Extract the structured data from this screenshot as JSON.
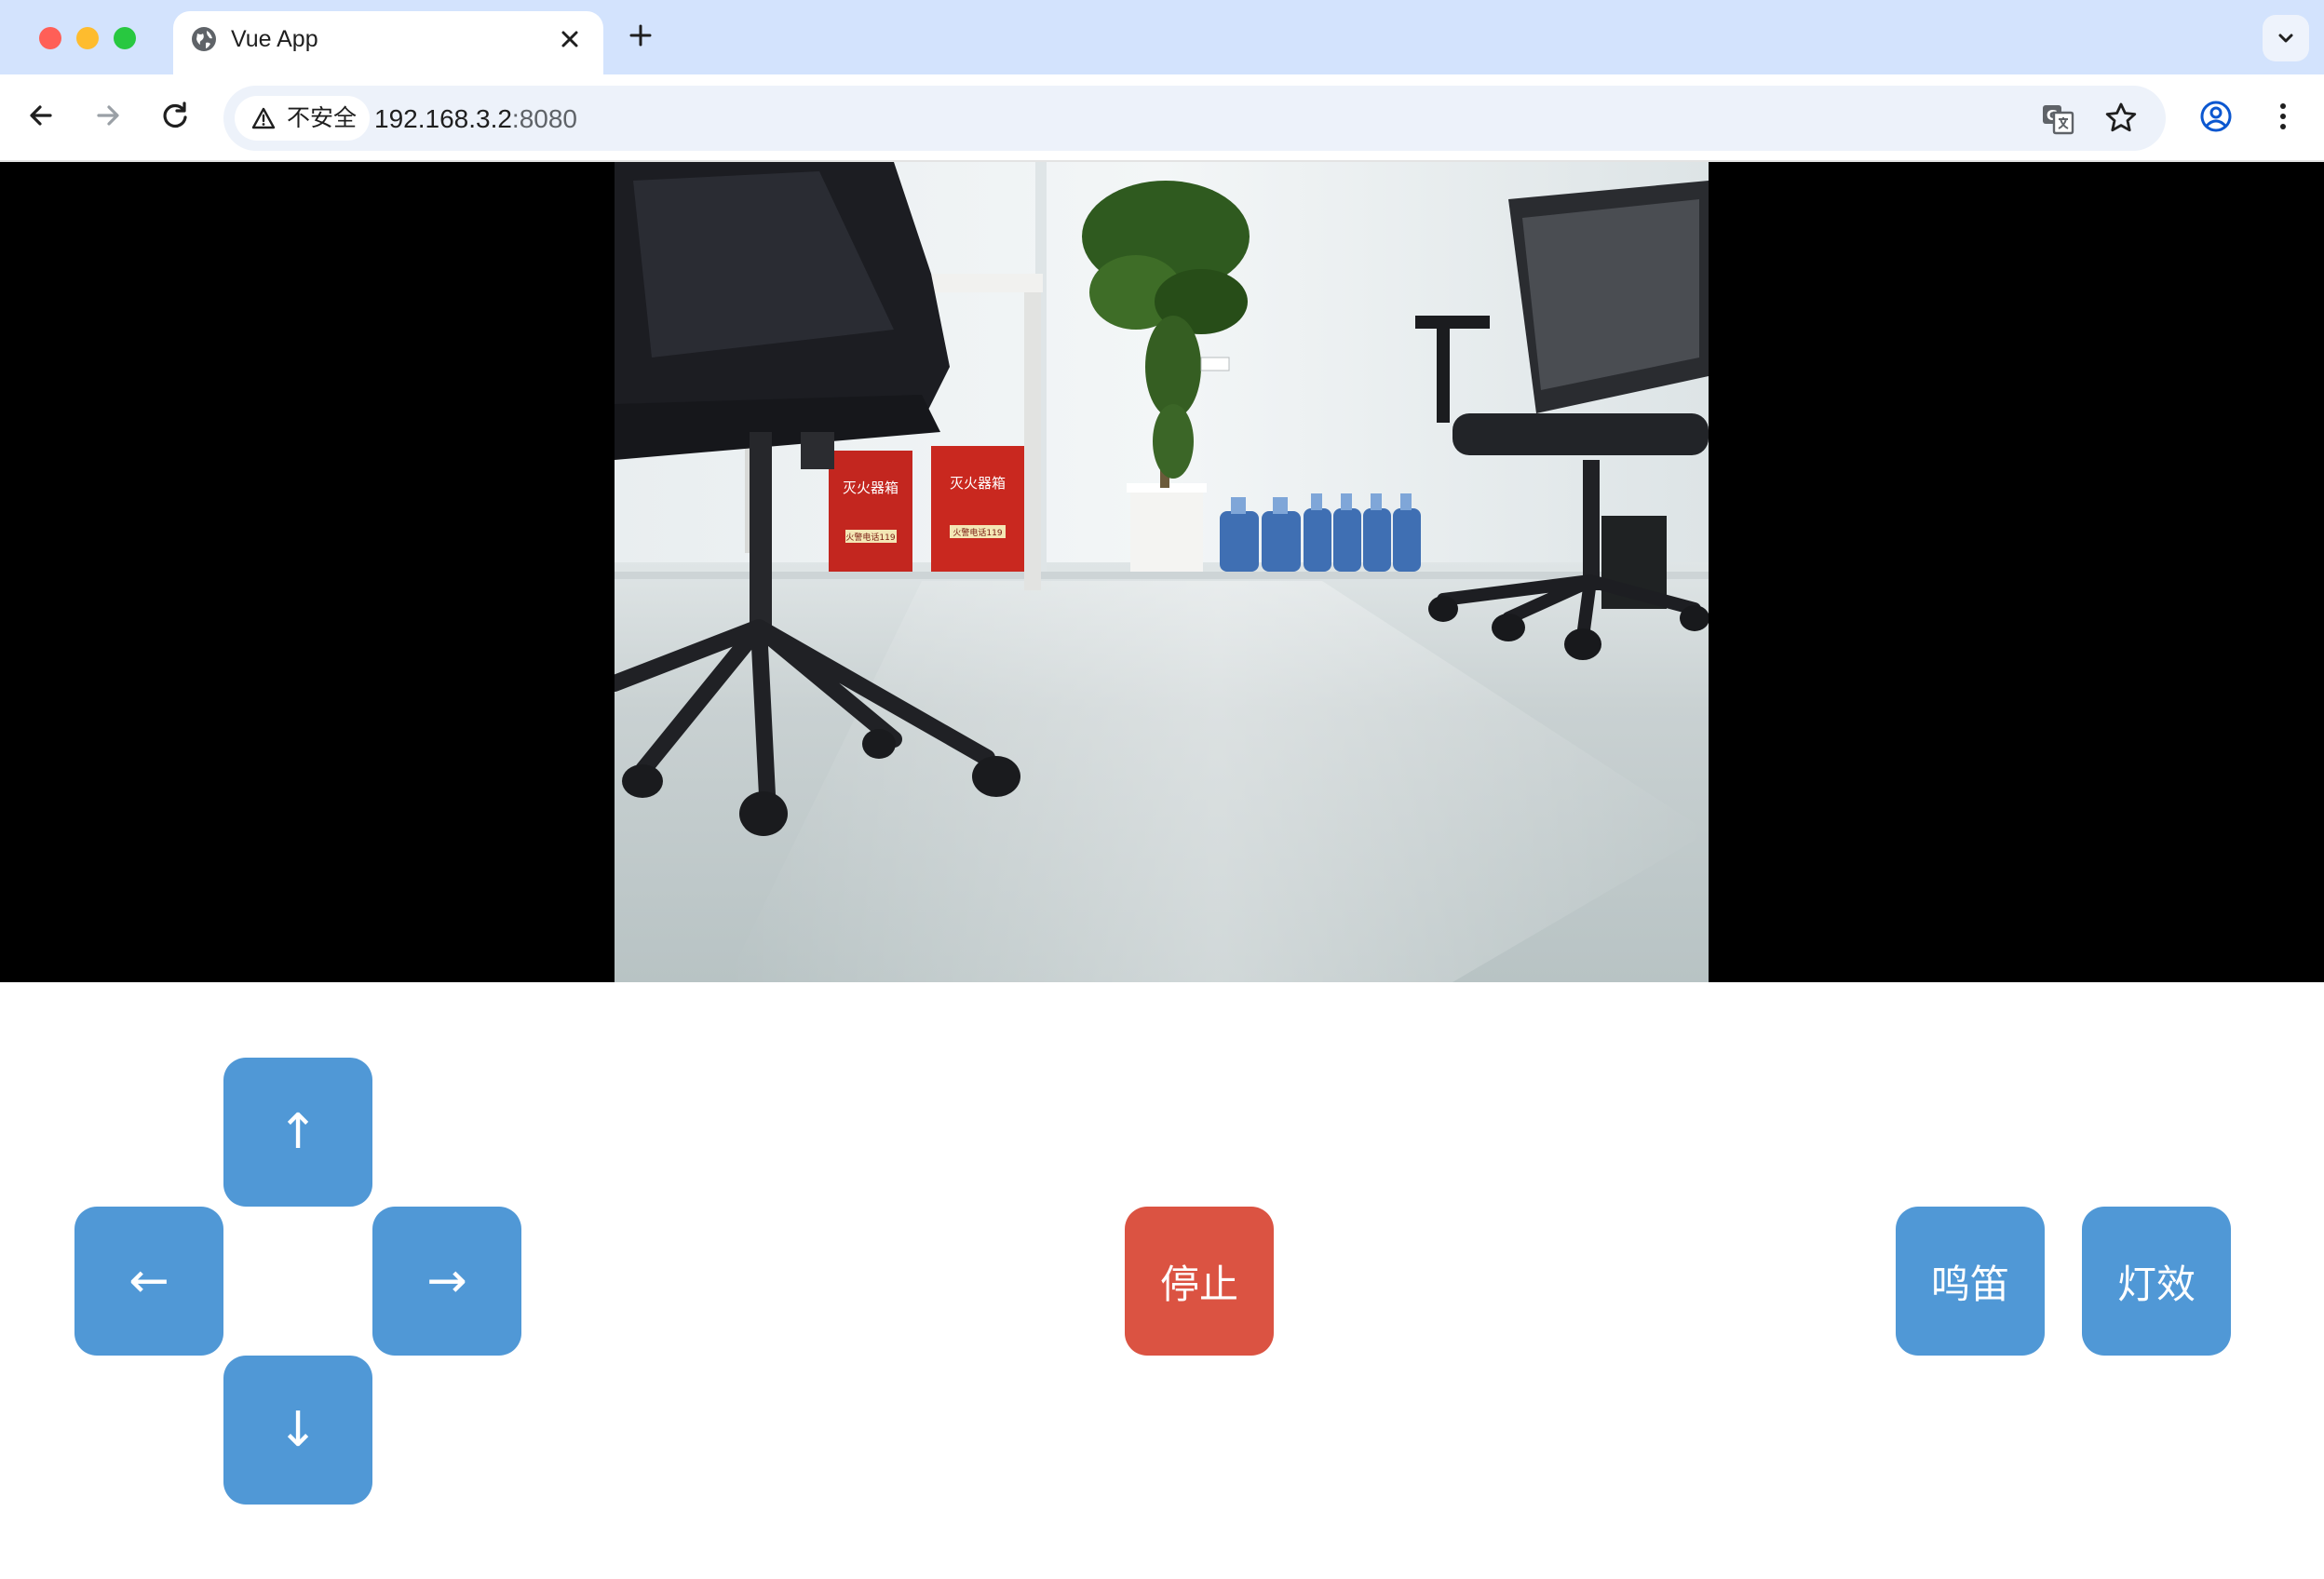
{
  "browser": {
    "tab_title": "Vue App",
    "security_label": "不安全",
    "url_host": "192.168.3.2",
    "url_port": ":8080"
  },
  "camera": {
    "fire_box_text_1": "灭火器箱",
    "fire_box_text_2": "灭火器箱",
    "fire_box_phone": "火警电话119"
  },
  "controls": {
    "up": "↑",
    "left": "←",
    "right": "→",
    "down": "↓",
    "stop": "停止",
    "horn": "鸣笛",
    "light": "灯效"
  },
  "colors": {
    "control_blue": "#5098d6",
    "stop_red": "#db5342",
    "tabstrip": "#d3e3fd"
  }
}
